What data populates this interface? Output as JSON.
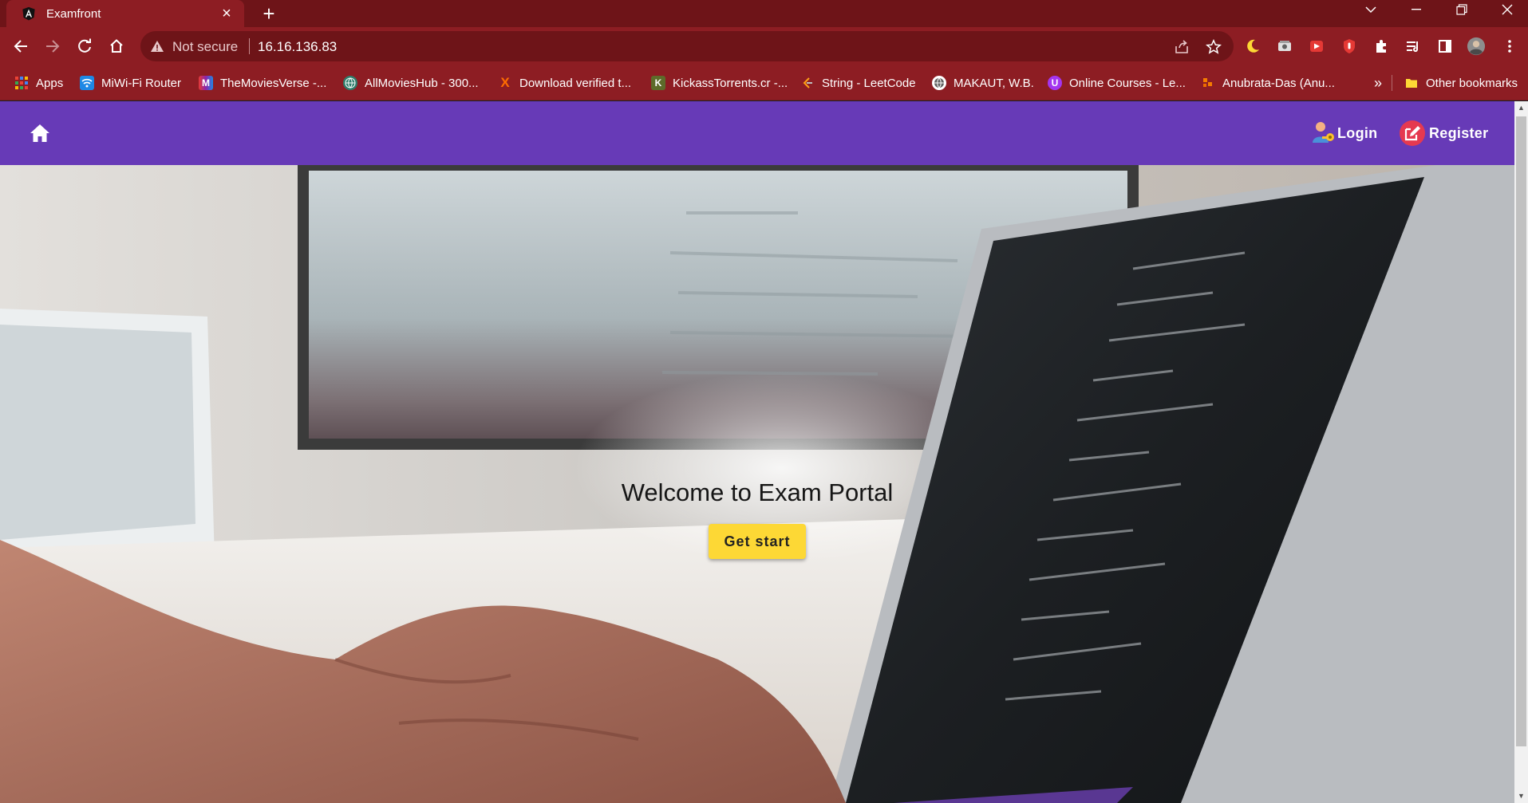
{
  "browser": {
    "tab": {
      "title": "Examfront",
      "close_glyph": "×"
    },
    "new_tab_glyph": "+",
    "address": {
      "security_label": "Not secure",
      "url": "16.16.136.83"
    },
    "bookmarks": [
      {
        "label": "Apps",
        "icon": "apps-grid-icon"
      },
      {
        "label": "MiWi-Fi Router",
        "icon": "wifi-icon"
      },
      {
        "label": "TheMoviesVerse -...",
        "icon": "m-logo-icon"
      },
      {
        "label": "AllMoviesHub - 300...",
        "icon": "globe-icon"
      },
      {
        "label": "Download verified t...",
        "icon": "x-logo-icon"
      },
      {
        "label": "KickassTorrents.cr -...",
        "icon": "k-logo-icon"
      },
      {
        "label": "String - LeetCode",
        "icon": "leetcode-icon"
      },
      {
        "label": "MAKAUT, W.B.",
        "icon": "globe-icon"
      },
      {
        "label": "Online Courses - Le...",
        "icon": "udemy-icon"
      },
      {
        "label": "Anubrata-Das (Anu...",
        "icon": "github-user-icon"
      }
    ],
    "overflow_glyph": "»",
    "other_bookmarks": "Other bookmarks"
  },
  "app": {
    "nav": {
      "login_label": "Login",
      "register_label": "Register"
    },
    "hero": {
      "title": "Welcome to Exam Portal",
      "button_label": "Get start"
    }
  },
  "colors": {
    "browser_frame": "#8d1d23",
    "tabstrip": "#6e1418",
    "app_toolbar": "#673ab7",
    "cta_button": "#fdd835",
    "register_badge": "#e53950"
  }
}
